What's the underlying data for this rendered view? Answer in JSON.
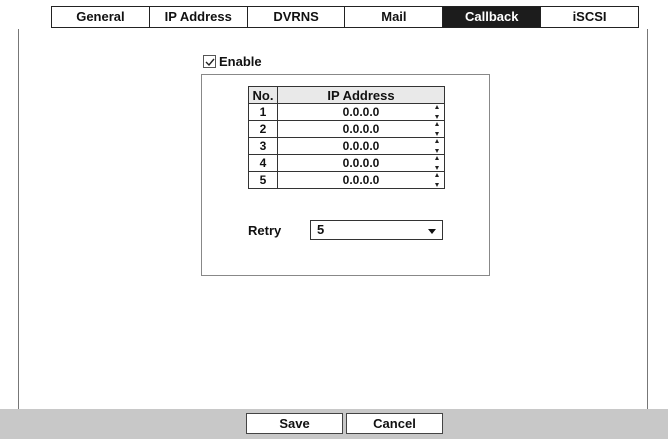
{
  "tabs": [
    {
      "label": "General",
      "active": false
    },
    {
      "label": "IP Address",
      "active": false
    },
    {
      "label": "DVRNS",
      "active": false
    },
    {
      "label": "Mail",
      "active": false
    },
    {
      "label": "Callback",
      "active": true
    },
    {
      "label": "iSCSI",
      "active": false
    }
  ],
  "enable": {
    "label": "Enable",
    "checked": true
  },
  "ip_table": {
    "headers": {
      "no": "No.",
      "ip": "IP Address"
    },
    "rows": [
      {
        "no": "1",
        "ip": "0.0.0.0"
      },
      {
        "no": "2",
        "ip": "0.0.0.0"
      },
      {
        "no": "3",
        "ip": "0.0.0.0"
      },
      {
        "no": "4",
        "ip": "0.0.0.0"
      },
      {
        "no": "5",
        "ip": "0.0.0.0"
      }
    ]
  },
  "retry": {
    "label": "Retry",
    "value": "5"
  },
  "footer": {
    "save_label": "Save",
    "cancel_label": "Cancel"
  },
  "icons": {
    "checkbox": "checkmark-icon",
    "spinner": "spinner-icon",
    "dropdown": "chevron-down-icon"
  }
}
